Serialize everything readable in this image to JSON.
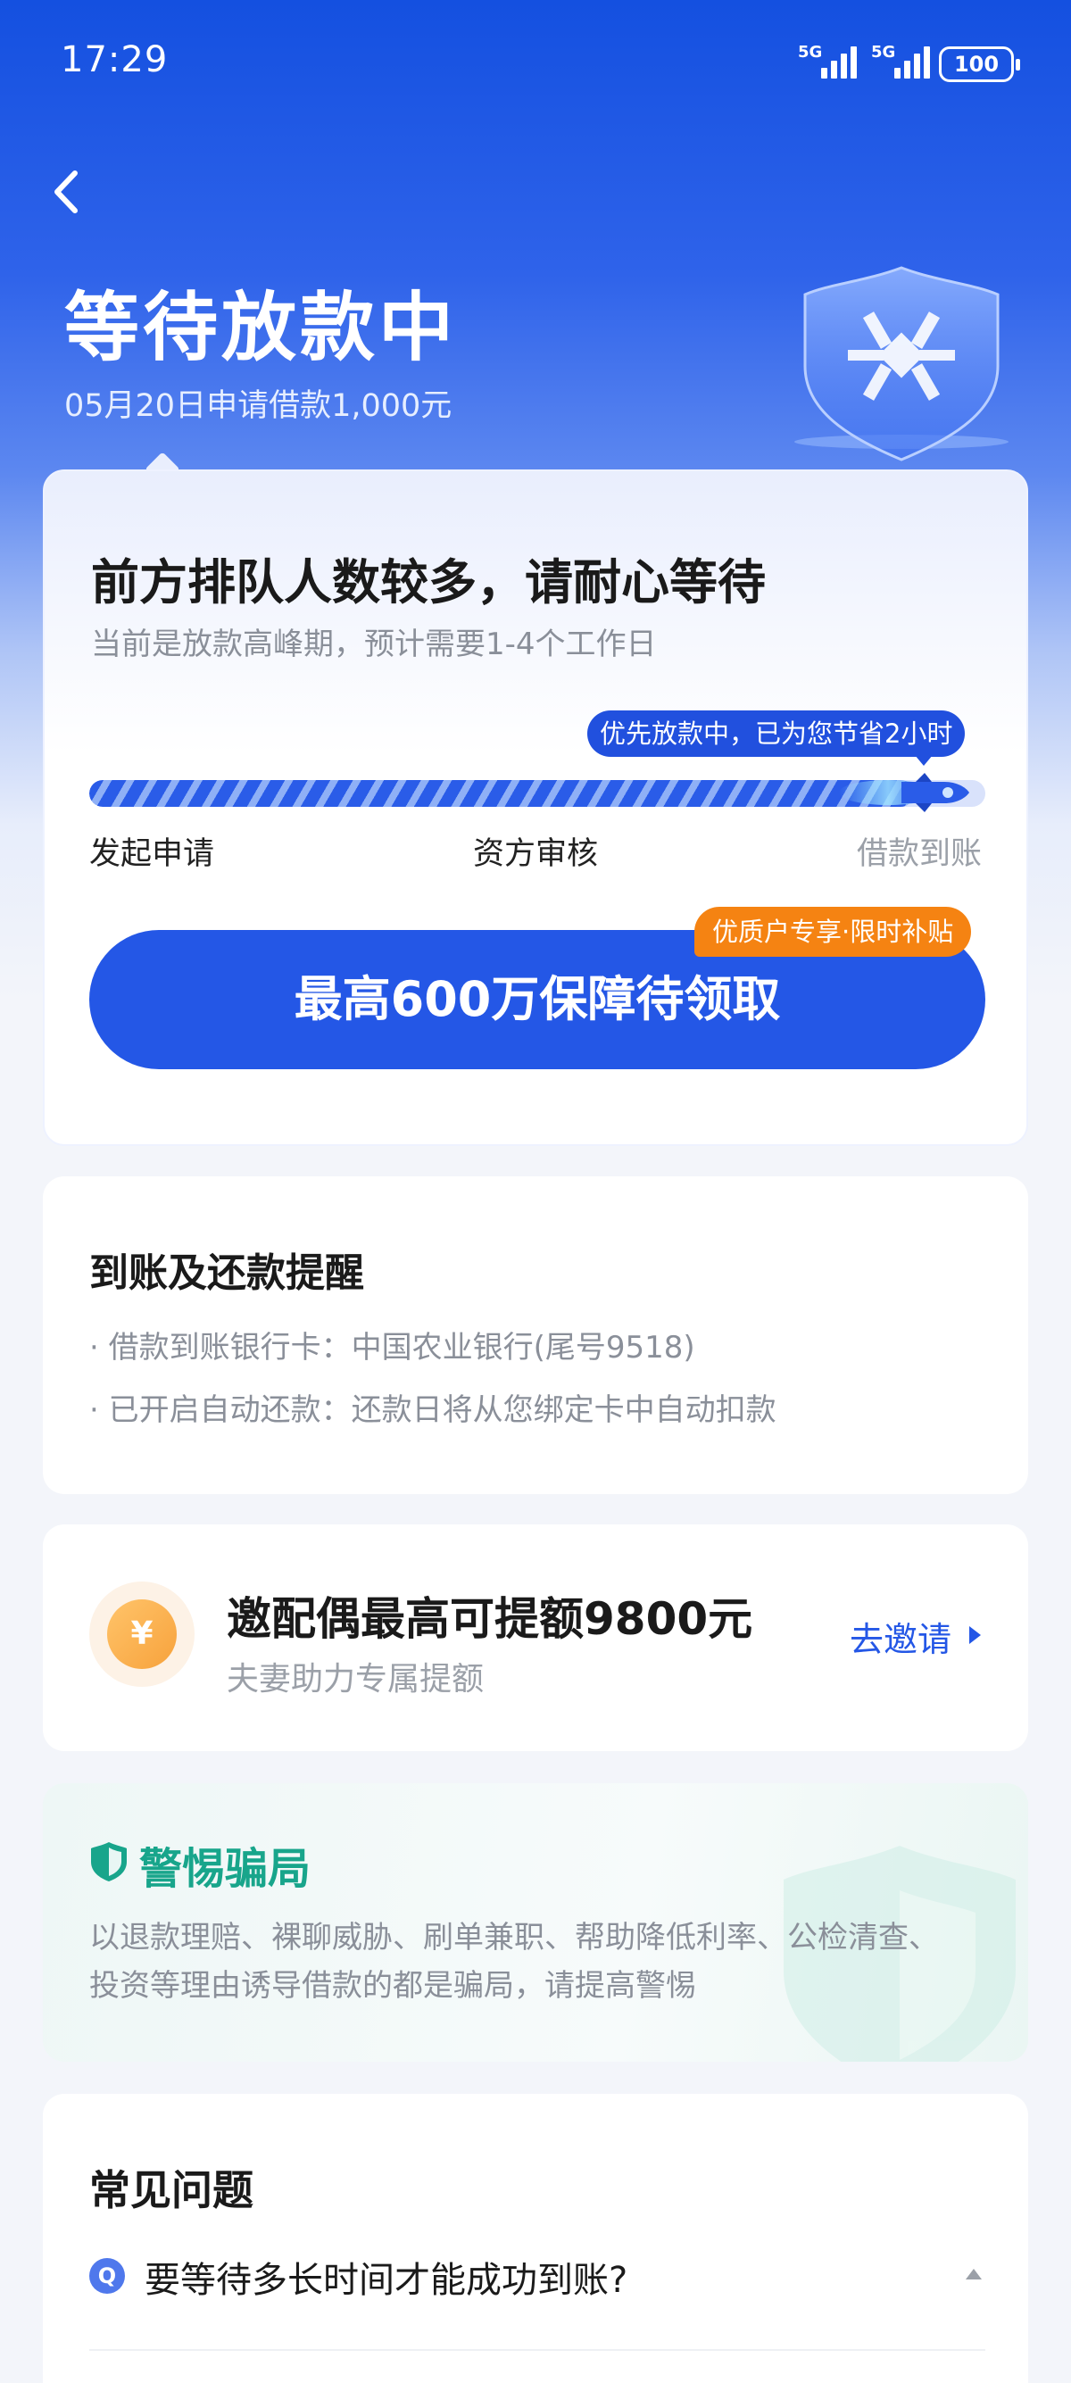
{
  "status_bar": {
    "time": "17:29",
    "signal_label": "5G",
    "battery": "100"
  },
  "header": {
    "title": "等待放款中",
    "subtitle": "05月20日申请借款1,000元"
  },
  "status_card": {
    "title": "前方排队人数较多，请耐心等待",
    "subtitle": "当前是放款高峰期，预计需要1-4个工作日",
    "tooltip": "优先放款中，已为您节省2小时",
    "progress_fraction": 0.92,
    "steps": [
      "发起申请",
      "资方审核",
      "借款到账"
    ],
    "cta_label": "最高600万保障待领取",
    "cta_tag": "优质户专享·限时补贴"
  },
  "remind_card": {
    "title": "到账及还款提醒",
    "items": [
      "借款到账银行卡：中国农业银行(尾号9518)",
      "已开启自动还款：还款日将从您绑定卡中自动扣款"
    ]
  },
  "invite_card": {
    "coin_symbol": "¥",
    "title": "邀配偶最高可提额9800元",
    "subtitle": "夫妻助力专属提额",
    "link_label": "去邀请"
  },
  "warn_card": {
    "title": "警惕骗局",
    "lines": [
      "以退款理赔、裸聊威胁、刷单兼职、帮助降低利率、公检清查、",
      "投资等理由诱导借款的都是骗局，请提高警惕"
    ]
  },
  "faq_card": {
    "title": "常见问题",
    "q_badge": "Q",
    "question": "要等待多长时间才能成功到账?"
  },
  "colors": {
    "primary": "#2457e6",
    "accent_orange": "#f58312",
    "warn_green": "#18a58b"
  }
}
